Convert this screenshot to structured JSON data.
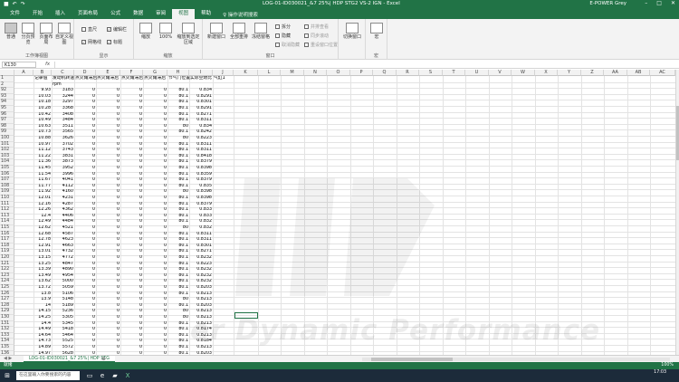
{
  "titlebar": {
    "title": "LOG-01-ID030021_&7 25%| HDP STG2 VS-2 IGN  -  Excel",
    "user": "E-POWER Grey",
    "qa_autosave": "■",
    "qa_undo": "↶",
    "qa_redo": "↷"
  },
  "tabs": [
    {
      "label": "文件"
    },
    {
      "label": "开始"
    },
    {
      "label": "插入"
    },
    {
      "label": "页面布局"
    },
    {
      "label": "公式"
    },
    {
      "label": "数据"
    },
    {
      "label": "审阅"
    },
    {
      "label": "视图"
    },
    {
      "label": "帮助"
    }
  ],
  "tell_me": "操作说明搜索",
  "ribbon": {
    "workbook_views": {
      "label": "工作簿视图",
      "buttons": [
        "普通",
        "分页预览",
        "页面布局",
        "自定义视图"
      ]
    },
    "show": {
      "label": "显示",
      "items": [
        {
          "label": "直尺",
          "checked": false
        },
        {
          "label": "编辑栏",
          "checked": true
        },
        {
          "label": "网格线",
          "checked": true
        },
        {
          "label": "标题",
          "checked": true
        }
      ]
    },
    "zoom": {
      "label": "缩放",
      "buttons": [
        "缩放",
        "100%",
        "缩放到选定区域"
      ]
    },
    "window": {
      "label": "窗口",
      "buttons": [
        "新建窗口",
        "全部重排",
        "冻结窗格"
      ],
      "small": [
        "拆分",
        "隐藏",
        "取消隐藏",
        "并排查看",
        "同步滚动",
        "重设窗口位置"
      ],
      "switch": "切换窗口"
    },
    "macro": {
      "label": "宏",
      "button": "宏"
    }
  },
  "formula_bar": {
    "name_box": "K130",
    "fx": "fx"
  },
  "columns": [
    "A",
    "B",
    "C",
    "D",
    "E",
    "F",
    "G",
    "H",
    "I",
    "J",
    "K",
    "L",
    "M",
    "N",
    "O",
    "P",
    "Q",
    "R",
    "S",
    "T",
    "U",
    "V",
    "W",
    "X",
    "Y",
    "Z",
    "AA",
    "AB",
    "AC"
  ],
  "header_row": {
    "row_num": "1",
    "labels": [
      "记录值",
      "发动机转速",
      "点火角滞后",
      "点火角滞后",
      "点火角滞后",
      "点火角滞后",
      "节气门位置",
      "实际空燃比",
      "气缸1"
    ]
  },
  "unit_row": {
    "row_num": "2",
    "labels": [
      "",
      "rpm",
      "",
      "",
      "",
      "",
      "",
      "",
      ""
    ]
  },
  "rows": [
    {
      "n": "92",
      "b": "9.93",
      "c": "3183",
      "d": "0",
      "e": "0",
      "f": "0",
      "g": "0",
      "h": "80.1",
      "i": "0.834"
    },
    {
      "n": "93",
      "b": "10.03",
      "c": "3244",
      "d": "0",
      "e": "0",
      "f": "0",
      "g": "0",
      "h": "80.1",
      "i": "0.8291"
    },
    {
      "n": "94",
      "b": "10.18",
      "c": "3297",
      "d": "0",
      "e": "0",
      "f": "0",
      "g": "0",
      "h": "80.1",
      "i": "0.8301"
    },
    {
      "n": "95",
      "b": "10.28",
      "c": "3368",
      "d": "0",
      "e": "0",
      "f": "0",
      "g": "0",
      "h": "80.1",
      "i": "0.8291"
    },
    {
      "n": "96",
      "b": "10.42",
      "c": "3408",
      "d": "0",
      "e": "0",
      "f": "0",
      "g": "0",
      "h": "80.1",
      "i": "0.8271"
    },
    {
      "n": "97",
      "b": "10.49",
      "c": "3484",
      "d": "0",
      "e": "0",
      "f": "0",
      "g": "0",
      "h": "80.1",
      "i": "0.8311"
    },
    {
      "n": "98",
      "b": "10.63",
      "c": "3511",
      "d": "0",
      "e": "0",
      "f": "0",
      "g": "0",
      "h": "80",
      "i": "0.834"
    },
    {
      "n": "99",
      "b": "10.73",
      "c": "3565",
      "d": "0",
      "e": "0",
      "f": "0",
      "g": "0",
      "h": "80.1",
      "i": "0.8242"
    },
    {
      "n": "100",
      "b": "10.88",
      "c": "3626",
      "d": "0",
      "e": "0",
      "f": "0",
      "g": "0",
      "h": "80",
      "i": "0.8223"
    },
    {
      "n": "101",
      "b": "10.97",
      "c": "3702",
      "d": "0",
      "e": "0",
      "f": "0",
      "g": "0",
      "h": "80.1",
      "i": "0.8311"
    },
    {
      "n": "102",
      "b": "11.12",
      "c": "3743",
      "d": "0",
      "e": "0",
      "f": "0",
      "g": "0",
      "h": "80.1",
      "i": "0.8311"
    },
    {
      "n": "103",
      "b": "11.22",
      "c": "3831",
      "d": "0",
      "e": "0",
      "f": "0",
      "g": "0",
      "h": "80.1",
      "i": "0.8418"
    },
    {
      "n": "104",
      "b": "11.36",
      "c": "3873",
      "d": "0",
      "e": "0",
      "f": "0",
      "g": "0",
      "h": "80.1",
      "i": "0.8379"
    },
    {
      "n": "105",
      "b": "11.45",
      "c": "3952",
      "d": "0",
      "e": "0",
      "f": "0",
      "g": "0",
      "h": "80.1",
      "i": "0.8398"
    },
    {
      "n": "106",
      "b": "11.54",
      "c": "3996",
      "d": "0",
      "e": "0",
      "f": "0",
      "g": "0",
      "h": "80.1",
      "i": "0.8359"
    },
    {
      "n": "107",
      "b": "11.67",
      "c": "4041",
      "d": "0",
      "e": "0",
      "f": "0",
      "g": "0",
      "h": "80.1",
      "i": "0.8379"
    },
    {
      "n": "108",
      "b": "11.77",
      "c": "4112",
      "d": "0",
      "e": "0",
      "f": "0",
      "g": "0",
      "h": "80.1",
      "i": "0.835"
    },
    {
      "n": "109",
      "b": "11.92",
      "c": "4160",
      "d": "0",
      "e": "0",
      "f": "0",
      "g": "0",
      "h": "80",
      "i": "0.8398"
    },
    {
      "n": "110",
      "b": "12.01",
      "c": "4231",
      "d": "0",
      "e": "0",
      "f": "0",
      "g": "0",
      "h": "80.1",
      "i": "0.8398"
    },
    {
      "n": "111",
      "b": "12.16",
      "c": "4287",
      "d": "0",
      "e": "0",
      "f": "0",
      "g": "0",
      "h": "80.1",
      "i": "0.8379"
    },
    {
      "n": "112",
      "b": "12.26",
      "c": "4362",
      "d": "0",
      "e": "0",
      "f": "0",
      "g": "0",
      "h": "80.1",
      "i": "0.833"
    },
    {
      "n": "113",
      "b": "12.4",
      "c": "4406",
      "d": "0",
      "e": "0",
      "f": "0",
      "g": "0",
      "h": "80.1",
      "i": "0.833"
    },
    {
      "n": "114",
      "b": "12.49",
      "c": "4484",
      "d": "0",
      "e": "0",
      "f": "0",
      "g": "0",
      "h": "80.1",
      "i": "0.832"
    },
    {
      "n": "115",
      "b": "12.62",
      "c": "4521",
      "d": "0",
      "e": "0",
      "f": "0",
      "g": "0",
      "h": "80",
      "i": "0.832"
    },
    {
      "n": "116",
      "b": "12.68",
      "c": "4587",
      "d": "0",
      "e": "0",
      "f": "0",
      "g": "0",
      "h": "80.1",
      "i": "0.8311"
    },
    {
      "n": "117",
      "b": "12.78",
      "c": "4623",
      "d": "0",
      "e": "0",
      "f": "0",
      "g": "0",
      "h": "80.1",
      "i": "0.8311"
    },
    {
      "n": "118",
      "b": "12.91",
      "c": "4663",
      "d": "0",
      "e": "0",
      "f": "0",
      "g": "0",
      "h": "80.1",
      "i": "0.8301"
    },
    {
      "n": "119",
      "b": "13.01",
      "c": "4732",
      "d": "0",
      "e": "0",
      "f": "0",
      "g": "0",
      "h": "80.1",
      "i": "0.8271"
    },
    {
      "n": "120",
      "b": "13.15",
      "c": "4772",
      "d": "0",
      "e": "0",
      "f": "0",
      "g": "0",
      "h": "80.1",
      "i": "0.8232"
    },
    {
      "n": "121",
      "b": "13.25",
      "c": "4847",
      "d": "0",
      "e": "0",
      "f": "0",
      "g": "0",
      "h": "80.1",
      "i": "0.8223"
    },
    {
      "n": "122",
      "b": "13.39",
      "c": "4890",
      "d": "0",
      "e": "0",
      "f": "0",
      "g": "0",
      "h": "80.1",
      "i": "0.8232"
    },
    {
      "n": "123",
      "b": "13.49",
      "c": "4954",
      "d": "0",
      "e": "0",
      "f": "0",
      "g": "0",
      "h": "80.1",
      "i": "0.8232"
    },
    {
      "n": "124",
      "b": "13.62",
      "c": "5000",
      "d": "0",
      "e": "0",
      "f": "0",
      "g": "0",
      "h": "80.1",
      "i": "0.8232"
    },
    {
      "n": "125",
      "b": "13.72",
      "c": "5059",
      "d": "0",
      "e": "0",
      "f": "0",
      "g": "0",
      "h": "80.1",
      "i": "0.8203"
    },
    {
      "n": "126",
      "b": "13.8",
      "c": "5106",
      "d": "0",
      "e": "0",
      "f": "0",
      "g": "0",
      "h": "80.1",
      "i": "0.8213"
    },
    {
      "n": "127",
      "b": "13.9",
      "c": "5148",
      "d": "0",
      "e": "0",
      "f": "0",
      "g": "0",
      "h": "80",
      "i": "0.8213"
    },
    {
      "n": "128",
      "b": "14",
      "c": "5189",
      "d": "0",
      "e": "0",
      "f": "0",
      "g": "0",
      "h": "80.1",
      "i": "0.8203"
    },
    {
      "n": "129",
      "b": "14.15",
      "c": "5236",
      "d": "0",
      "e": "0",
      "f": "0",
      "g": "0",
      "h": "80",
      "i": "0.8213"
    },
    {
      "n": "130",
      "b": "14.25",
      "c": "5305",
      "d": "0",
      "e": "0",
      "f": "0",
      "g": "0",
      "h": "80",
      "i": "0.8213"
    },
    {
      "n": "131",
      "b": "14.4",
      "c": "5345",
      "d": "0",
      "e": "0",
      "f": "0",
      "g": "0",
      "h": "80.1",
      "i": "0.8213"
    },
    {
      "n": "132",
      "b": "14.49",
      "c": "5418",
      "d": "0",
      "e": "0",
      "f": "0",
      "g": "0",
      "h": "80.1",
      "i": "0.8174"
    },
    {
      "n": "133",
      "b": "14.64",
      "c": "5464",
      "d": "0",
      "e": "0",
      "f": "0",
      "g": "0",
      "h": "80.1",
      "i": "0.8213"
    },
    {
      "n": "134",
      "b": "14.73",
      "c": "5525",
      "d": "0",
      "e": "0",
      "f": "0",
      "g": "0",
      "h": "80.1",
      "i": "0.8184"
    },
    {
      "n": "135",
      "b": "14.89",
      "c": "5572",
      "d": "0",
      "e": "0",
      "f": "0",
      "g": "0",
      "h": "80.1",
      "i": "0.8213"
    },
    {
      "n": "136",
      "b": "14.97",
      "c": "5628",
      "d": "0",
      "e": "0",
      "f": "0",
      "g": "0",
      "h": "80.1",
      "i": "0.8203"
    }
  ],
  "watermark": "er Dynamic Performance",
  "sheet_tab": "LOG-01-ID030021_&7 25%| HDP STG",
  "sheet_add": "⊕",
  "status": {
    "ready": "就绪",
    "zoom": "100%"
  },
  "taskbar": {
    "search_placeholder": "在这里输入你要搜索的内容",
    "time": "17:03",
    "date": "2021/1/1"
  },
  "colors": {
    "excel_green": "#217346",
    "taskbar": "#1c2b3a"
  }
}
